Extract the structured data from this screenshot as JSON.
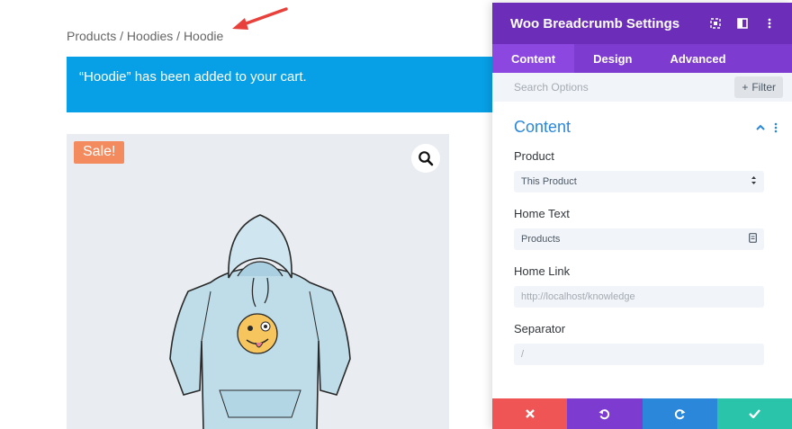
{
  "page": {
    "breadcrumb": "Products / Hoodies / Hoodie",
    "notice": "“Hoodie” has been added to your cart.",
    "sale_badge": "Sale!"
  },
  "panel": {
    "title": "Woo Breadcrumb Settings",
    "tabs": [
      {
        "label": "Content",
        "active": true
      },
      {
        "label": "Design",
        "active": false
      },
      {
        "label": "Advanced",
        "active": false
      }
    ],
    "search_placeholder": "Search Options",
    "filter_label": "Filter",
    "section_title": "Content",
    "fields": [
      {
        "label": "Product",
        "value": "This Product",
        "kind": "select"
      },
      {
        "label": "Home Text",
        "value": "Products",
        "kind": "text"
      },
      {
        "label": "Home Link",
        "value": "http://localhost/knowledge",
        "kind": "text"
      },
      {
        "label": "Separator",
        "value": "/",
        "kind": "text"
      }
    ]
  },
  "colors": {
    "header": "#6c2eb9",
    "tabs": "#7d3bcf",
    "notice": "#07a0e6",
    "sale": "#f38b5e",
    "cancel": "#ef5555",
    "undo": "#7e3bd0",
    "redo": "#2b87da",
    "save": "#29c4a9"
  },
  "icons": [
    "arrow-annotation-icon",
    "search-zoom-icon",
    "expand-icon",
    "sidebar-icon",
    "more-vertical-icon",
    "plus-icon",
    "chevron-up-icon",
    "select-arrows-icon",
    "dynamic-content-icon",
    "close-icon",
    "undo-icon",
    "redo-icon",
    "check-icon"
  ]
}
